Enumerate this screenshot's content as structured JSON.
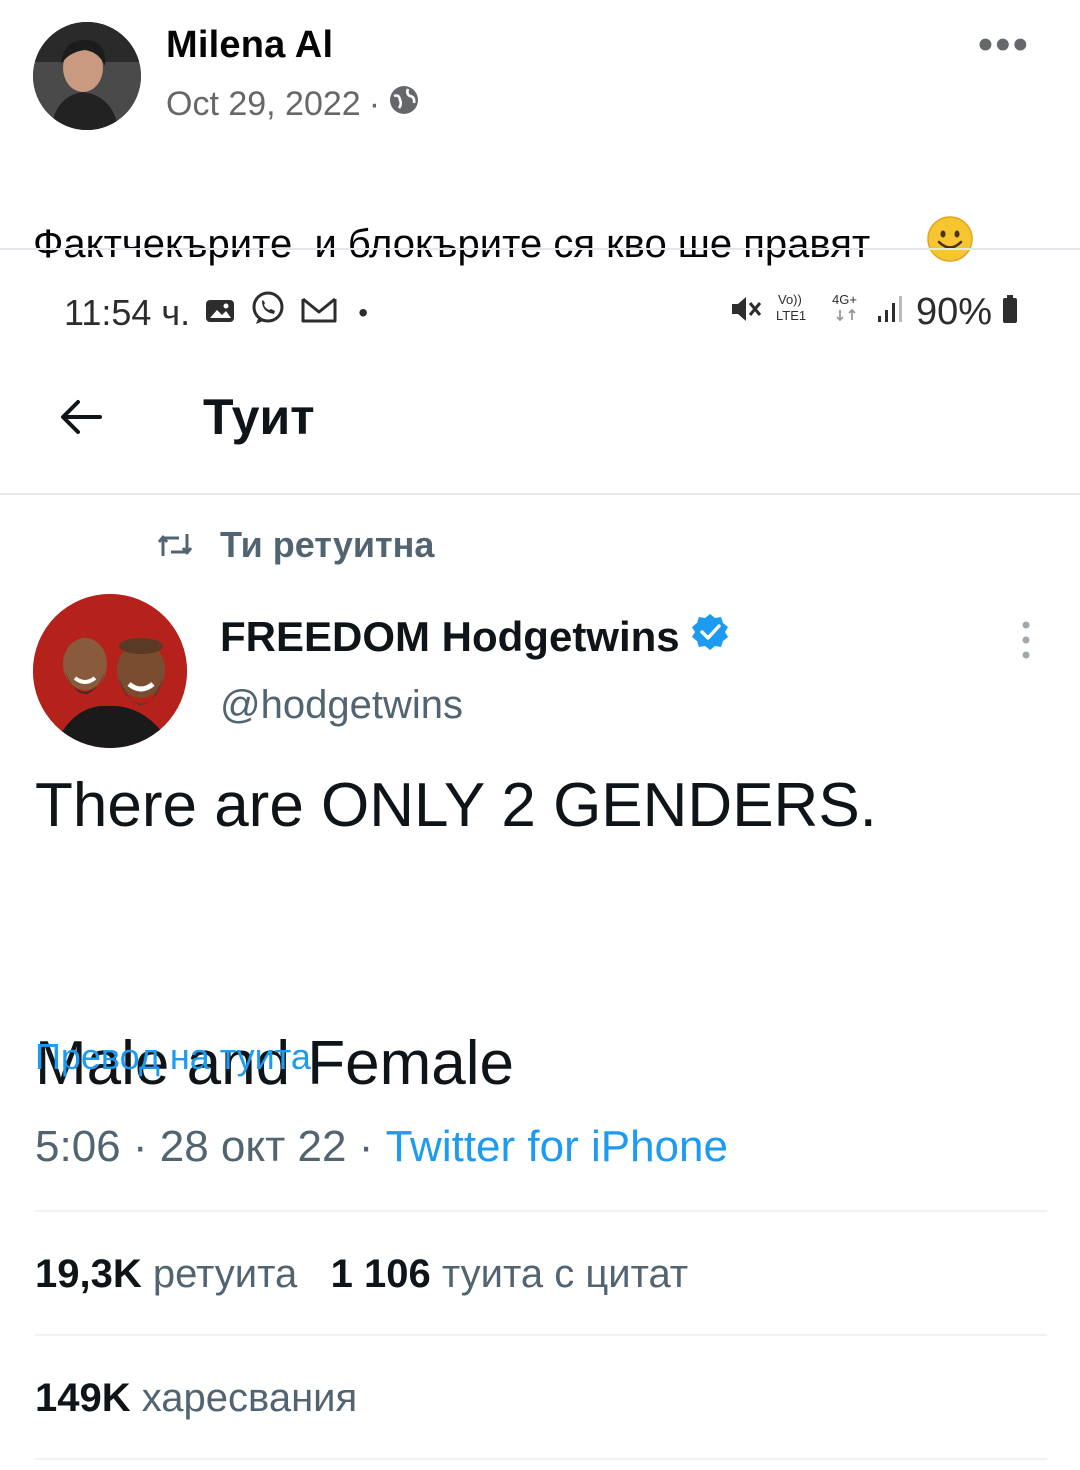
{
  "post": {
    "author": "Milena Al",
    "date": "Oct 29, 2022",
    "date_separator": "·",
    "more_label": "•••",
    "caption": "Фактчекърите  и блокърите ся кво ше правят ",
    "privacy_icon": "globe-icon",
    "emoji_icon": "smiley-emoji"
  },
  "status_bar": {
    "time": "11:54 ч.",
    "dot": "•",
    "battery": "90%",
    "icons_left": [
      "gallery-icon",
      "viber-icon",
      "gmail-icon"
    ],
    "icons_right": [
      "mute-icon",
      "volte-icon",
      "4g-icon",
      "signal-icon",
      "battery-icon"
    ]
  },
  "tweet": {
    "header_title": "Туит",
    "retweet_label": "Ти ретуитна",
    "author_name": "FREEDOM Hodgetwins",
    "handle": "@hodgetwins",
    "text": "There are ONLY 2 GENDERS.\n\n\nMale and Female",
    "translate_label": "Превод на туита",
    "time": "5:06",
    "date": "28 окт 22",
    "meta_sep": "·",
    "source": "Twitter for iPhone",
    "retweets_count": "19,3K",
    "retweets_label": "ретуита",
    "quotes_count": "1 106",
    "quotes_label": "туита с цитат",
    "likes_count": "149K",
    "likes_label": "харесвания",
    "accent_color": "#1d9bf0"
  }
}
